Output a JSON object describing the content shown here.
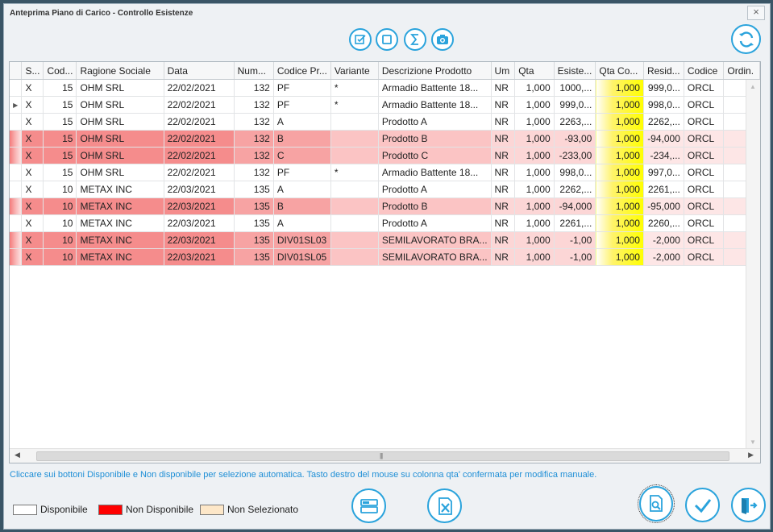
{
  "window": {
    "title": "Anteprima Piano di Carico - Controllo Esistenze"
  },
  "toolbar": {
    "buttons": [
      {
        "icon": "checkbox-edit-icon"
      },
      {
        "icon": "square-icon"
      },
      {
        "icon": "sigma-icon"
      },
      {
        "icon": "camera-icon"
      }
    ],
    "refresh_icon": "refresh-icon"
  },
  "grid": {
    "columns": [
      "S...",
      "Cod...",
      "Ragione Sociale",
      "Data",
      "Num...",
      "Codice Pr...",
      "Variante",
      "Descrizione Prodotto",
      "Um",
      "Qta",
      "Esiste...",
      "Qta Co...",
      "Resid...",
      "Codice",
      "Ordin."
    ],
    "rows": [
      {
        "status": "white",
        "current": false,
        "cells": [
          "X",
          "15",
          "OHM SRL",
          "22/02/2021",
          "132",
          "PF",
          "*",
          "Armadio Battente 18...",
          "NR",
          "1,000",
          "1000,...",
          "1,000",
          "999,0...",
          "ORCL",
          ""
        ]
      },
      {
        "status": "white",
        "current": true,
        "cells": [
          "X",
          "15",
          "OHM SRL",
          "22/02/2021",
          "132",
          "PF",
          "*",
          "Armadio Battente 18...",
          "NR",
          "1,000",
          "999,0...",
          "1,000",
          "998,0...",
          "ORCL",
          ""
        ]
      },
      {
        "status": "white",
        "current": false,
        "cells": [
          "X",
          "15",
          "OHM SRL",
          "22/02/2021",
          "132",
          "A",
          "",
          "Prodotto A",
          "NR",
          "1,000",
          "2263,...",
          "1,000",
          "2262,...",
          "ORCL",
          ""
        ]
      },
      {
        "status": "red",
        "current": false,
        "cells": [
          "X",
          "15",
          "OHM SRL",
          "22/02/2021",
          "132",
          "B",
          "",
          "Prodotto B",
          "NR",
          "1,000",
          "-93,00",
          "1,000",
          "-94,000",
          "ORCL",
          ""
        ]
      },
      {
        "status": "red",
        "current": false,
        "cells": [
          "X",
          "15",
          "OHM SRL",
          "22/02/2021",
          "132",
          "C",
          "",
          "Prodotto C",
          "NR",
          "1,000",
          "-233,00",
          "1,000",
          "-234,...",
          "ORCL",
          ""
        ]
      },
      {
        "status": "white",
        "current": false,
        "cells": [
          "X",
          "15",
          "OHM SRL",
          "22/02/2021",
          "132",
          "PF",
          "*",
          "Armadio Battente 18...",
          "NR",
          "1,000",
          "998,0...",
          "1,000",
          "997,0...",
          "ORCL",
          ""
        ]
      },
      {
        "status": "white",
        "current": false,
        "cells": [
          "X",
          "10",
          "METAX INC",
          "22/03/2021",
          "135",
          "A",
          "",
          "Prodotto A",
          "NR",
          "1,000",
          "2262,...",
          "1,000",
          "2261,...",
          "ORCL",
          ""
        ]
      },
      {
        "status": "red",
        "current": false,
        "cells": [
          "X",
          "10",
          "METAX INC",
          "22/03/2021",
          "135",
          "B",
          "",
          "Prodotto B",
          "NR",
          "1,000",
          "-94,000",
          "1,000",
          "-95,000",
          "ORCL",
          ""
        ]
      },
      {
        "status": "white",
        "current": false,
        "cells": [
          "X",
          "10",
          "METAX INC",
          "22/03/2021",
          "135",
          "A",
          "",
          "Prodotto A",
          "NR",
          "1,000",
          "2261,...",
          "1,000",
          "2260,...",
          "ORCL",
          ""
        ]
      },
      {
        "status": "red",
        "current": false,
        "cells": [
          "X",
          "10",
          "METAX INC",
          "22/03/2021",
          "135",
          "DIV01SL03",
          "",
          "SEMILAVORATO BRA...",
          "NR",
          "1,000",
          "-1,00",
          "1,000",
          "-2,000",
          "ORCL",
          ""
        ]
      },
      {
        "status": "red",
        "current": false,
        "cells": [
          "X",
          "10",
          "METAX INC",
          "22/03/2021",
          "135",
          "DIV01SL05",
          "",
          "SEMILAVORATO BRA...",
          "NR",
          "1,000",
          "-1,00",
          "1,000",
          "-2,000",
          "ORCL",
          ""
        ]
      }
    ]
  },
  "hint": "Cliccare sui bottoni Disponibile e Non disponibile per selezione automatica. Tasto destro del mouse su colonna qta' confermata per modifica manuale.",
  "legend": [
    {
      "label": "Disponibile",
      "color": "#ffffff"
    },
    {
      "label": "Non Disponibile",
      "color": "#ff0000"
    },
    {
      "label": "Non Selezionato",
      "color": "#fde7c8"
    }
  ],
  "colors": {
    "accent": "#2aa3dc",
    "hint_text": "#1f8fd6",
    "confirmed_qty": "#ffff00"
  }
}
